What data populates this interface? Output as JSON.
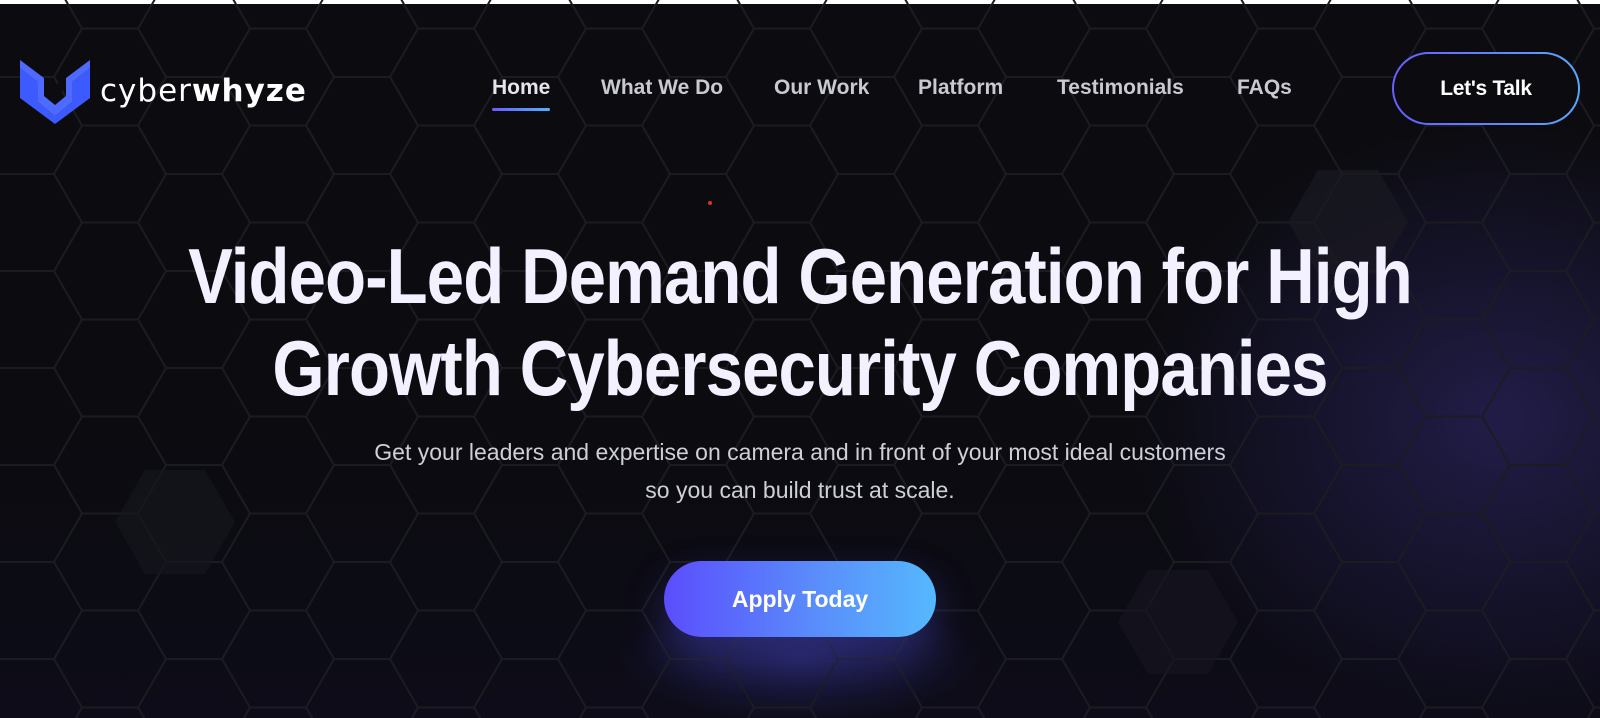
{
  "header": {
    "logo": {
      "icon": "cyberwhyze-logo-icon",
      "text_light": "cyber",
      "text_bold": "whyze"
    },
    "nav": [
      {
        "label": "Home",
        "active": true
      },
      {
        "label": "What We Do",
        "active": false
      },
      {
        "label": "Our Work",
        "active": false
      },
      {
        "label": "Platform",
        "active": false
      },
      {
        "label": "Testimonials",
        "active": false
      },
      {
        "label": "FAQs",
        "active": false
      }
    ],
    "cta_label": "Let's Talk"
  },
  "hero": {
    "title_line1": "Video-Led Demand Generation for High",
    "title_line2": "Growth Cybersecurity Companies",
    "subtitle_line1": "Get your leaders and expertise on camera and in front of your most ideal customers",
    "subtitle_line2": "so you can build trust at scale.",
    "cta_label": "Apply Today"
  },
  "colors": {
    "background": "#0b0b0f",
    "accent_start": "#5b4dfc",
    "accent_end": "#55b8fd",
    "logo_blue": "#3d5afe",
    "title": "#f3f1ff"
  }
}
